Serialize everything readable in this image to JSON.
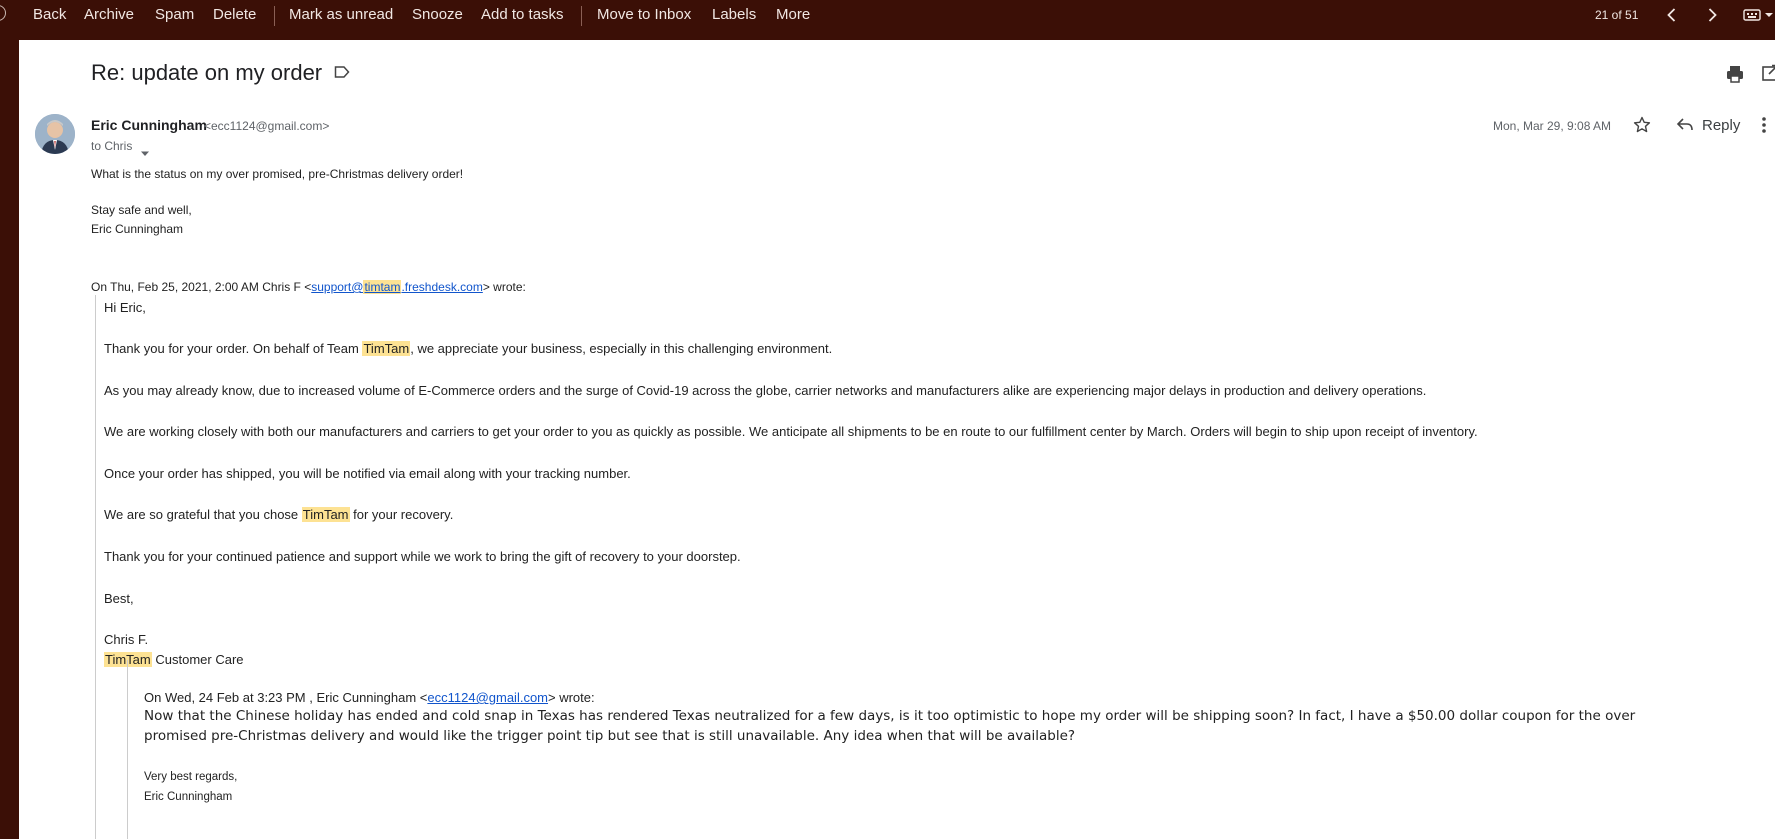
{
  "toolbar": {
    "back": "Back",
    "archive": "Archive",
    "spam": "Spam",
    "delete": "Delete",
    "mark_unread": "Mark as unread",
    "snooze": "Snooze",
    "add_tasks": "Add to tasks",
    "move_inbox": "Move to Inbox",
    "labels": "Labels",
    "more": "More",
    "pagination": "21 of 51"
  },
  "email": {
    "subject": "Re: update on my order",
    "sender_name": "Eric Cunningham",
    "sender_email": "<ecc1124@gmail.com>",
    "to": "to Chris",
    "date": "Mon, Mar 29, 9:08 AM",
    "reply_label": "Reply",
    "body_line1": "What is the status on my over promised, pre-Christmas delivery order!",
    "sign_line1": "Stay safe and well,",
    "sign_line2": "Eric Cunningham"
  },
  "quote1": {
    "header_pre": "On Thu, Feb 25, 2021, 2:00 AM Chris F <",
    "link_a": "support@",
    "link_hl": "timtam",
    "link_b": ".freshdesk.com",
    "header_post": "> wrote:",
    "greeting": "Hi Eric,",
    "p1_pre": "Thank you for your order. On behalf of Team ",
    "brand": "TimTam",
    "p1_post": ", we appreciate your business, especially in this challenging environment.",
    "p2": "As you may already know, due to increased volume of E-Commerce orders and the surge of Covid-19 across the globe, carrier networks and manufacturers alike are experiencing major delays in production and delivery operations.",
    "p3": "We are working closely with both our manufacturers and carriers to get your order to you as quickly as possible. We anticipate all shipments to be en route to our fulfillment center by March. Orders will begin to ship upon receipt of inventory.",
    "p4": "Once your order has shipped, you will be notified via email along with your tracking number.",
    "p5_pre": "We are so grateful that you chose ",
    "p5_post": " for your recovery.",
    "p6": "Thank you for your continued patience and support while we work to bring the gift of recovery to your doorstep.",
    "best": "Best,",
    "sig_name": "Chris F.",
    "sig_team": " Customer Care"
  },
  "quote2": {
    "header_pre": "On Wed, 24 Feb at 3:23 PM , Eric Cunningham <",
    "header_link": "ecc1124@gmail.com",
    "header_post": "> wrote:",
    "body_line1": "Now that the Chinese holiday has ended and cold snap in Texas has rendered Texas neutralized for a few days, is it too optimistic to hope my order will be shipping soon? In fact, I have a $50.00 dollar coupon for the over",
    "body_line2": "promised pre-Christmas delivery and would like the trigger point tip but see that is still unavailable. Any idea when that will be available?",
    "regards": "Very best regards,",
    "name": "Eric Cunningham"
  },
  "colors": {
    "chrome_background": "#3b0f06",
    "highlight": "#fde293",
    "link": "#1155cc"
  }
}
